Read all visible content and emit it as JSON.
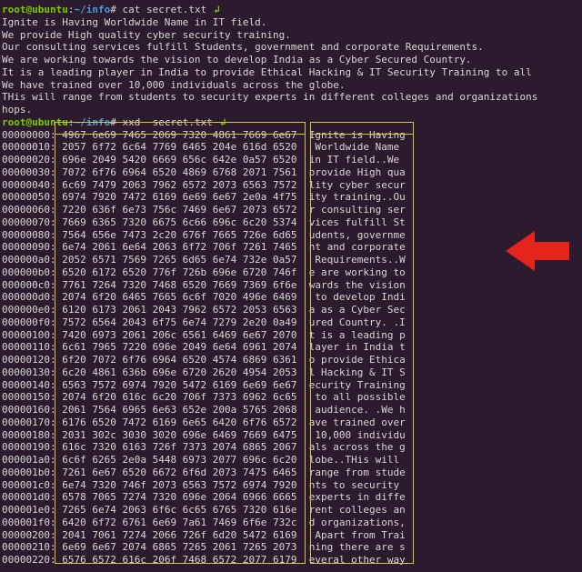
{
  "prompt": {
    "user_host": "root@ubuntu",
    "colon": ":",
    "path": "~/info",
    "hash": "# "
  },
  "cmd1": "cat secret.txt",
  "cat_output": [
    "Ignite is Having Worldwide Name in IT field.",
    "We provide High quality cyber security training.",
    "Our consulting services fulfill Students, government and corporate Requirements.",
    "We are working towards the vision to develop India as a Cyber Secured Country.",
    "It is a leading player in India to provide Ethical Hacking & IT Security Training to all",
    "We have trained over 10,000 individuals across the globe.",
    "THis will range from students to security experts in different colleges and organizations",
    "hops."
  ],
  "cmd2": "xxd  secret.txt",
  "xxd_rows": [
    {
      "off": "00000000:",
      "hex": "4967 6e69 7465 2069 7320 4861 7669 6e67",
      "asc": "Ignite is Having"
    },
    {
      "off": "00000010:",
      "hex": "2057 6f72 6c64 7769 6465 204e 616d 6520",
      "asc": " Worldwide Name "
    },
    {
      "off": "00000020:",
      "hex": "696e 2049 5420 6669 656c 642e 0a57 6520",
      "asc": "in IT field..We "
    },
    {
      "off": "00000030:",
      "hex": "7072 6f76 6964 6520 4869 6768 2071 7561",
      "asc": "provide High qua"
    },
    {
      "off": "00000040:",
      "hex": "6c69 7479 2063 7962 6572 2073 6563 7572",
      "asc": "lity cyber secur"
    },
    {
      "off": "00000050:",
      "hex": "6974 7920 7472 6169 6e69 6e67 2e0a 4f75",
      "asc": "ity training..Ou"
    },
    {
      "off": "00000060:",
      "hex": "7220 636f 6e73 756c 7469 6e67 2073 6572",
      "asc": "r consulting ser"
    },
    {
      "off": "00000070:",
      "hex": "7669 6365 7320 6675 6c66 696c 6c20 5374",
      "asc": "vices fulfill St"
    },
    {
      "off": "00000080:",
      "hex": "7564 656e 7473 2c20 676f 7665 726e 6d65",
      "asc": "udents, governme"
    },
    {
      "off": "00000090:",
      "hex": "6e74 2061 6e64 2063 6f72 706f 7261 7465",
      "asc": "nt and corporate"
    },
    {
      "off": "000000a0:",
      "hex": "2052 6571 7569 7265 6d65 6e74 732e 0a57",
      "asc": " Requirements..W"
    },
    {
      "off": "000000b0:",
      "hex": "6520 6172 6520 776f 726b 696e 6720 746f",
      "asc": "e are working to"
    },
    {
      "off": "000000c0:",
      "hex": "7761 7264 7320 7468 6520 7669 7369 6f6e",
      "asc": "wards the vision"
    },
    {
      "off": "000000d0:",
      "hex": "2074 6f20 6465 7665 6c6f 7020 496e 6469",
      "asc": " to develop Indi"
    },
    {
      "off": "000000e0:",
      "hex": "6120 6173 2061 2043 7962 6572 2053 6563",
      "asc": "a as a Cyber Sec"
    },
    {
      "off": "000000f0:",
      "hex": "7572 6564 2043 6f75 6e74 7279 2e20 0a49",
      "asc": "ured Country. .I"
    },
    {
      "off": "00000100:",
      "hex": "7420 6973 2061 206c 6561 6469 6e67 2070",
      "asc": "t is a leading p"
    },
    {
      "off": "00000110:",
      "hex": "6c61 7965 7220 696e 2049 6e64 6961 2074",
      "asc": "layer in India t"
    },
    {
      "off": "00000120:",
      "hex": "6f20 7072 6f76 6964 6520 4574 6869 6361",
      "asc": "o provide Ethica"
    },
    {
      "off": "00000130:",
      "hex": "6c20 4861 636b 696e 6720 2620 4954 2053",
      "asc": "l Hacking & IT S"
    },
    {
      "off": "00000140:",
      "hex": "6563 7572 6974 7920 5472 6169 6e69 6e67",
      "asc": "ecurity Training"
    },
    {
      "off": "00000150:",
      "hex": "2074 6f20 616c 6c20 706f 7373 6962 6c65",
      "asc": " to all possible"
    },
    {
      "off": "00000160:",
      "hex": "2061 7564 6965 6e63 652e 200a 5765 2068",
      "asc": " audience. .We h"
    },
    {
      "off": "00000170:",
      "hex": "6176 6520 7472 6169 6e65 6420 6f76 6572",
      "asc": "ave trained over"
    },
    {
      "off": "00000180:",
      "hex": "2031 302c 3030 3020 696e 6469 7669 6475",
      "asc": " 10,000 individu"
    },
    {
      "off": "00000190:",
      "hex": "616c 7320 6163 726f 7373 2074 6865 2067",
      "asc": "als across the g"
    },
    {
      "off": "000001a0:",
      "hex": "6c6f 6265 2e0a 5448 6973 2077 696c 6c20",
      "asc": "lobe..THis will "
    },
    {
      "off": "000001b0:",
      "hex": "7261 6e67 6520 6672 6f6d 2073 7475 6465",
      "asc": "range from stude"
    },
    {
      "off": "000001c0:",
      "hex": "6e74 7320 746f 2073 6563 7572 6974 7920",
      "asc": "nts to security "
    },
    {
      "off": "000001d0:",
      "hex": "6578 7065 7274 7320 696e 2064 6966 6665",
      "asc": "experts in diffe"
    },
    {
      "off": "000001e0:",
      "hex": "7265 6e74 2063 6f6c 6c65 6765 7320 616e",
      "asc": "rent colleges an"
    },
    {
      "off": "000001f0:",
      "hex": "6420 6f72 6761 6e69 7a61 7469 6f6e 732c",
      "asc": "d organizations,"
    },
    {
      "off": "00000200:",
      "hex": "2041 7061 7274 2066 726f 6d20 5472 6169",
      "asc": " Apart from Trai"
    },
    {
      "off": "00000210:",
      "hex": "6e69 6e67 2074 6865 7265 2061 7265 2073",
      "asc": "ning there are s"
    },
    {
      "off": "00000220:",
      "hex": "6576 6572 616c 206f 7468 6572 2077 6179",
      "asc": "everal other way"
    }
  ]
}
